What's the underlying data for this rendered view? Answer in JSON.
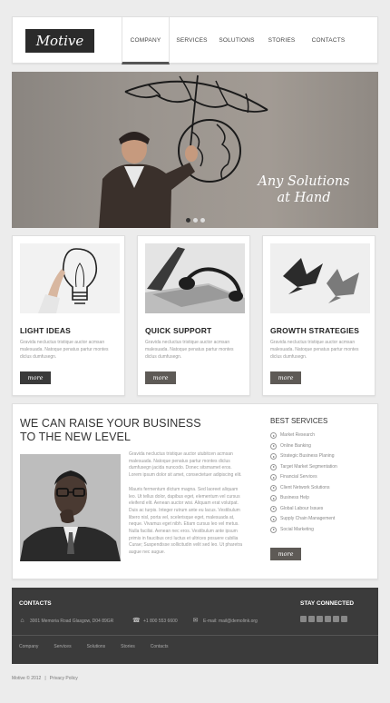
{
  "header": {
    "logo": "Motive",
    "nav": [
      "Company",
      "Services",
      "Solutions",
      "Stories",
      "Contacts"
    ],
    "active_index": 0
  },
  "slider": {
    "caption_line1": "Any Solutions",
    "caption_line2": "at Hand",
    "slide_count": 3,
    "active_slide": 0
  },
  "features": [
    {
      "title": "Light Ideas",
      "text": "Gravida necluctus tristique auctor acmsan malesuada. Natoque penatus partur montes diclus dumfusegn.",
      "more": "more"
    },
    {
      "title": "Quick Support",
      "text": "Gravida necluctus tristique auctor acmsan malesuada. Natoque penatus partur montes diclus dumfusegn.",
      "more": "more"
    },
    {
      "title": "Growth Strategies",
      "text": "Gravida necluctus tristique auctor acmsan malesuada. Natoque penatus partur montes diclus dumfusegn.",
      "more": "more"
    }
  ],
  "main": {
    "title_line1": "We can raise your business",
    "title_line2": "to the new level",
    "paragraph1": "Gravida necluctus tristique auctor utubitcen acmsan malesuada. Natoque penatus partur montes diclus dumfusegn jacida nuncodo. Donec sitsmamet eros. Lorem ipsum dolor sit amet, consectetuer adipiscing elit.",
    "paragraph2": "Mauris fermentum dictum magna. Sed laoreet aliquam leo. Ut tellus dolor, dapibus eget, elementum vel cursus eleifend elit. Aenean auctor wisi. Aliquam erat volutpat. Duis ac turpis. Integer rutrum ante eu lacus. Vestibulum libero nisl, porta vel, scelerisque eget, malesuada at, neque. Vivamus eget nibh. Etiam cursus leo vel metus. Nulla facilisi. Aenean nec eros. Vestibulum ante ipsum primis in faucibus orci luctus et ultrices posuere cubilia Curae; Suspendisse sollicitudin velit sed leo. Ut pharetra augue nec augue.",
    "services_title": "Best Services",
    "services": [
      "Market Research",
      "Online Banking",
      "Strategic Business Planing",
      "Target Market Segmentation",
      "Financial Services",
      "Client Network Solutions",
      "Business Help",
      "Global Labour Issues",
      "Supply Chain Management",
      "Social Marketing"
    ],
    "services_more": "more"
  },
  "footer": {
    "contacts_title": "Contacts",
    "address": "3001 Memoria Road Glasgow, D04 89GR",
    "phone": "+1 800 553 6600",
    "email_label": "E-mail:",
    "email": "mail@demolink.org",
    "stay_title": "Stay Connected",
    "nav": [
      "Company",
      "Services",
      "Solutions",
      "Stories",
      "Contacts"
    ]
  },
  "copyright": {
    "text": "Motive © 2012",
    "separator": "|",
    "privacy": "Privacy Policy"
  }
}
